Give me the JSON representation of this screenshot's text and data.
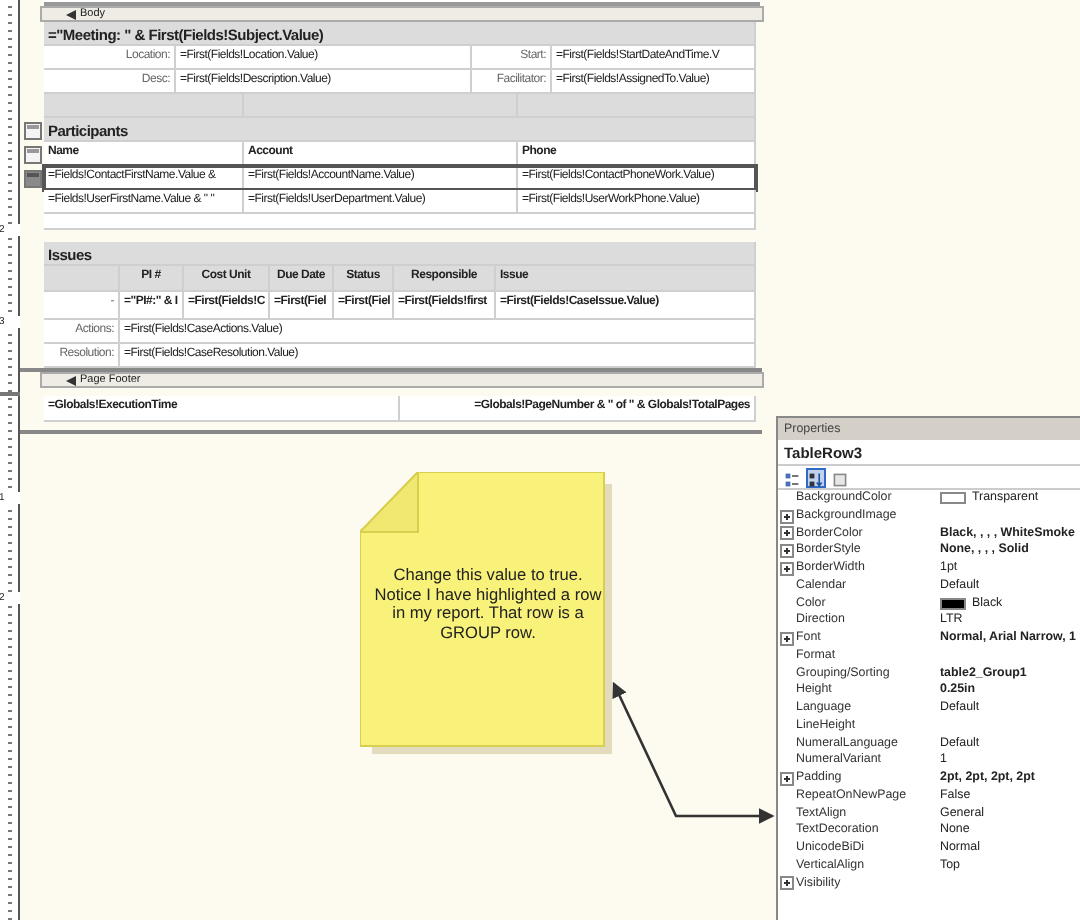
{
  "ruler": {
    "body_numbers": [
      "2",
      "3"
    ],
    "footer_numbers": [
      "1",
      "2"
    ]
  },
  "body_band": {
    "label": "Body"
  },
  "meeting": {
    "title": "=\"Meeting: \" & First(Fields!Subject.Value)",
    "rows": [
      {
        "label": "Location:",
        "value": "=First(Fields!Location.Value)",
        "label_2": "Start:",
        "value_2": "=First(Fields!StartDateAndTime.V"
      },
      {
        "label": "Desc:",
        "value": "=First(Fields!Description.Value)",
        "label_2": "Facilitator:",
        "value_2": "=First(Fields!AssignedTo.Value)"
      }
    ]
  },
  "participants": {
    "title": "Participants",
    "columns": [
      "Name",
      "Account",
      "Phone"
    ],
    "rows": [
      {
        "selected": true,
        "cells": [
          "=Fields!ContactFirstName.Value &",
          "=First(Fields!AccountName.Value)",
          "=First(Fields!ContactPhoneWork.Value)"
        ]
      },
      {
        "selected": false,
        "cells": [
          "=Fields!UserFirstName.Value & \" \"",
          "=First(Fields!UserDepartment.Value)",
          "=First(Fields!UserWorkPhone.Value)"
        ]
      }
    ]
  },
  "issues": {
    "title": "Issues",
    "columns": [
      "PI #",
      "Cost Unit",
      "Due Date",
      "Status",
      "Responsible",
      "Issue"
    ],
    "row": {
      "marker": "-",
      "cells": [
        "=\"PI#:\" & I",
        "=First(Fields!C",
        "=First(Fiel",
        "=First(Fiel",
        "=First(Fields!first",
        "=First(Fields!CaseIssue.Value)"
      ]
    },
    "details": [
      {
        "label": "Actions:",
        "value": "=First(Fields!CaseActions.Value)"
      },
      {
        "label": "Resolution:",
        "value": "=First(Fields!CaseResolution.Value)"
      }
    ]
  },
  "footer_band": {
    "label": "Page Footer"
  },
  "footer": {
    "left": "=Globals!ExecutionTime",
    "right": "=Globals!PageNumber & \" of \" & Globals!TotalPages"
  },
  "note": {
    "text": "Change this value to true.  Notice I have highlighted a row in my report.  That row is a GROUP row."
  },
  "properties": {
    "title": "Properties",
    "object": "TableRow3",
    "toolbar": [
      {
        "kind": "categorized",
        "selected": false
      },
      {
        "kind": "alphabetical",
        "selected": true
      },
      {
        "kind": "pages",
        "selected": false
      }
    ],
    "rows": [
      {
        "name": "BackgroundColor",
        "value": "Transparent",
        "bold": false,
        "expandable": false,
        "color": "#ffffff"
      },
      {
        "name": "BackgroundImage",
        "expandable": true
      },
      {
        "name": "BorderColor",
        "value": "Black, , , , WhiteSmoke",
        "bold": true,
        "expandable": true
      },
      {
        "name": "BorderStyle",
        "value": "None, , , , Solid",
        "bold": true,
        "expandable": true
      },
      {
        "name": "BorderWidth",
        "value": "1pt",
        "bold": false,
        "expandable": true
      },
      {
        "name": "Calendar",
        "value": "Default",
        "bold": false,
        "expandable": false
      },
      {
        "name": "Color",
        "value": "Black",
        "bold": false,
        "expandable": false,
        "color": "#000000"
      },
      {
        "name": "Direction",
        "value": "LTR",
        "bold": false,
        "expandable": false
      },
      {
        "name": "Font",
        "value": "Normal, Arial Narrow, 1",
        "bold": true,
        "expandable": true
      },
      {
        "name": "Format",
        "expandable": false
      },
      {
        "name": "Grouping/Sorting",
        "value": "table2_Group1",
        "bold": true,
        "expandable": false
      },
      {
        "name": "Height",
        "value": "0.25in",
        "bold": true,
        "expandable": false
      },
      {
        "name": "Language",
        "value": "Default",
        "bold": false,
        "expandable": false
      },
      {
        "name": "LineHeight",
        "expandable": false
      },
      {
        "name": "NumeralLanguage",
        "value": "Default",
        "bold": false,
        "expandable": false
      },
      {
        "name": "NumeralVariant",
        "value": "1",
        "bold": false,
        "expandable": false
      },
      {
        "name": "Padding",
        "value": "2pt, 2pt, 2pt, 2pt",
        "bold": true,
        "expandable": true
      },
      {
        "name": "RepeatOnNewPage",
        "value": "False",
        "bold": false,
        "expandable": false
      },
      {
        "name": "TextAlign",
        "value": "General",
        "bold": false,
        "expandable": false
      },
      {
        "name": "TextDecoration",
        "value": "None",
        "bold": false,
        "expandable": false
      },
      {
        "name": "UnicodeBiDi",
        "value": "Normal",
        "bold": false,
        "expandable": false
      },
      {
        "name": "VerticalAlign",
        "value": "Top",
        "bold": false,
        "expandable": false
      },
      {
        "name": "Visibility",
        "expandable": true
      }
    ]
  }
}
